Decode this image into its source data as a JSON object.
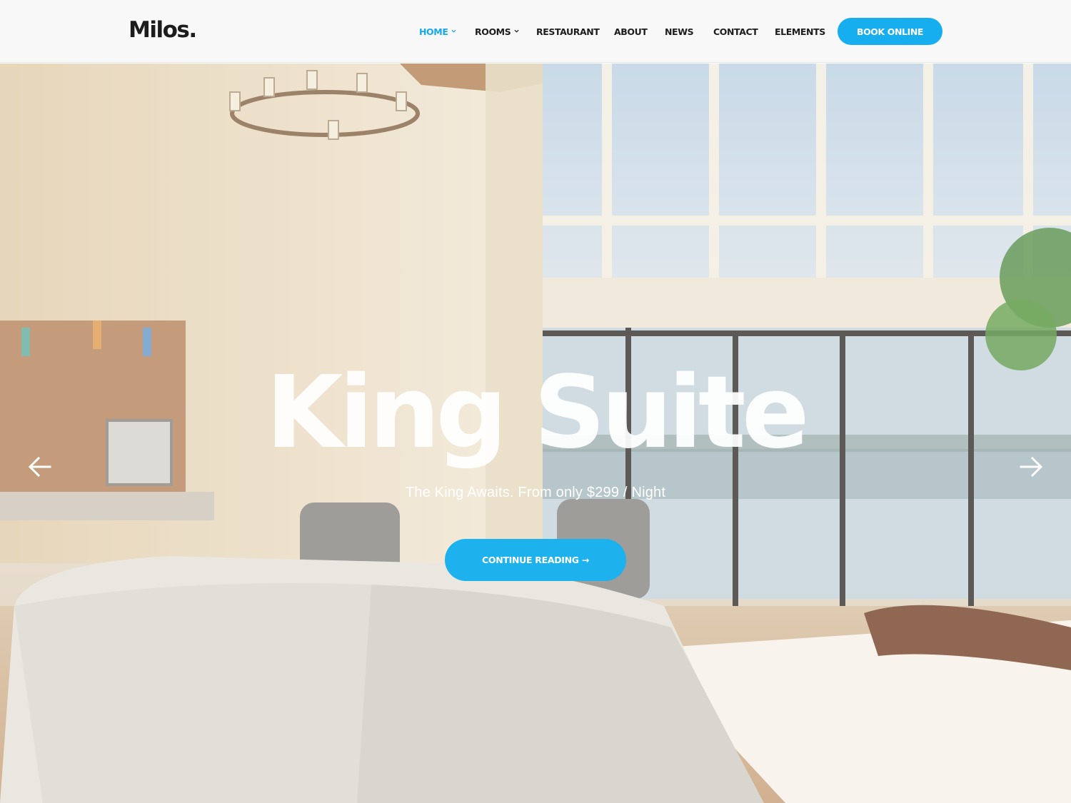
{
  "header": {
    "logo": "Milos.",
    "nav": [
      {
        "label": "HOME",
        "active": true,
        "dropdown": true
      },
      {
        "label": "ROOMS",
        "active": false,
        "dropdown": true
      },
      {
        "label": "RESTAURANT",
        "active": false,
        "dropdown": false
      },
      {
        "label": "ABOUT",
        "active": false,
        "dropdown": false
      },
      {
        "label": "NEWS",
        "active": false,
        "dropdown": false
      },
      {
        "label": "CONTACT",
        "active": false,
        "dropdown": false
      },
      {
        "label": "ELEMENTS",
        "active": false,
        "dropdown": false
      }
    ],
    "book_label": "BOOK ONLINE"
  },
  "hero": {
    "title": "King Suite",
    "subtitle": "The King Awaits. From only $299 / Night",
    "cta_label": "CONTINUE READING →",
    "prev_icon": "arrow-left-icon",
    "next_icon": "arrow-right-icon"
  },
  "colors": {
    "accent": "#17aef0",
    "active_nav": "#17a9ec",
    "text_dark": "#1c1c1c",
    "header_bg": "#f8f8f8"
  }
}
